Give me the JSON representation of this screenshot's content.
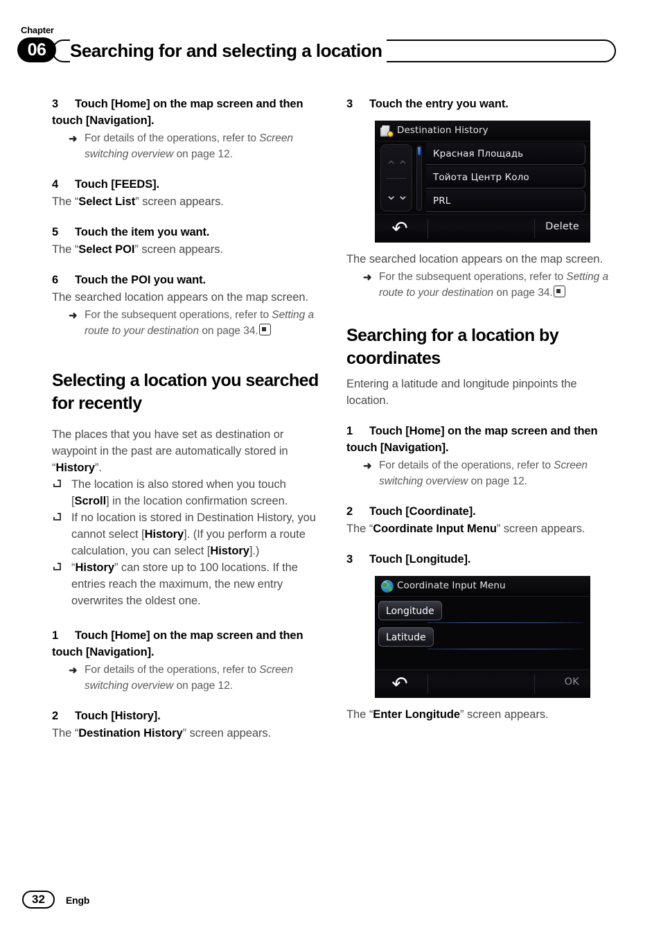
{
  "header": {
    "chapter_label": "Chapter",
    "chapter_number": "06",
    "title": "Searching for and selecting a location"
  },
  "footer": {
    "page_number": "32",
    "language_code": "Engb"
  },
  "left_column": {
    "step3": {
      "num": "3",
      "text": "Touch [Home] on the map screen and then touch [Navigation].",
      "note_pre": "For details of the operations, refer to ",
      "note_italic": "Screen switching overview",
      "note_post": " on page 12."
    },
    "step4": {
      "num": "4",
      "text": "Touch [FEEDS].",
      "body_pre": "The “",
      "body_bold": "Select List",
      "body_post": "” screen appears."
    },
    "step5": {
      "num": "5",
      "text": "Touch the item you want.",
      "body_pre": "The “",
      "body_bold": "Select POI",
      "body_post": "” screen appears."
    },
    "step6": {
      "num": "6",
      "text": "Touch the POI you want.",
      "body": "The searched location appears on the map screen.",
      "note_pre": "For the subsequent operations, refer to ",
      "note_italic": "Setting a route to your destination",
      "note_post": " on page 34."
    },
    "section_title": "Selecting a location you searched for recently",
    "intro_pre": "The places that you have set as destination or waypoint in the past are automatically stored in “",
    "intro_bold": "History",
    "intro_post": "”.",
    "bullets": [
      {
        "pre": "The location is also stored when you touch [",
        "bold": "Scroll",
        "post": "] in the location confirmation screen."
      },
      {
        "pre": "If no location is stored in Destination History, you cannot select [",
        "bold": "History",
        "mid": "]. (If you perform a route calculation, you can select [",
        "bold2": "History",
        "post": "].)"
      },
      {
        "pre": "“",
        "bold": "History",
        "post": "” can store up to 100 locations. If the entries reach the maximum, the new entry overwrites the oldest one."
      }
    ],
    "step1": {
      "num": "1",
      "text": "Touch [Home] on the map screen and then touch [Navigation].",
      "note_pre": "For details of the operations, refer to ",
      "note_italic": "Screen switching overview",
      "note_post": " on page 12."
    },
    "step2": {
      "num": "2",
      "text": "Touch [History].",
      "body_pre": "The “",
      "body_bold": "Destination History",
      "body_post": "” screen appears."
    }
  },
  "right_column": {
    "step3": {
      "num": "3",
      "text": "Touch the entry you want."
    },
    "destination_history_screen": {
      "title": "Destination History",
      "title_icon": "history-page-icon",
      "scroll_up_icon": "chevron-double-up-icon",
      "scroll_down_icon": "chevron-double-down-icon",
      "entries": [
        "Красная Площадь",
        "Тойота Центр Коло",
        "PRL"
      ],
      "back_icon": "back-arrow-icon",
      "action_label": "Delete"
    },
    "after_history_body": "The searched location appears on the map screen.",
    "after_history_note_pre": "For the subsequent operations, refer to ",
    "after_history_note_italic": "Setting a route to your destination",
    "after_history_note_post": " on page 34.",
    "section_title": "Searching for a location by coordinates",
    "intro": "Entering a latitude and longitude pinpoints the location.",
    "step1": {
      "num": "1",
      "text": "Touch [Home] on the map screen and then touch [Navigation].",
      "note_pre": "For details of the operations, refer to ",
      "note_italic": "Screen switching overview",
      "note_post": " on page 12."
    },
    "step2": {
      "num": "2",
      "text": "Touch [Coordinate].",
      "body_pre": "The “",
      "body_bold": "Coordinate Input Menu",
      "body_post": "” screen appears."
    },
    "step3b": {
      "num": "3",
      "text": "Touch [Longitude]."
    },
    "coordinate_input_screen": {
      "title": "Coordinate Input Menu",
      "title_icon": "globe-icon",
      "longitude_label": "Longitude",
      "latitude_label": "Latitude",
      "back_icon": "back-arrow-icon",
      "action_label": "OK"
    },
    "closing_pre": "The “",
    "closing_bold": "Enter Longitude",
    "closing_post": "” screen appears."
  }
}
